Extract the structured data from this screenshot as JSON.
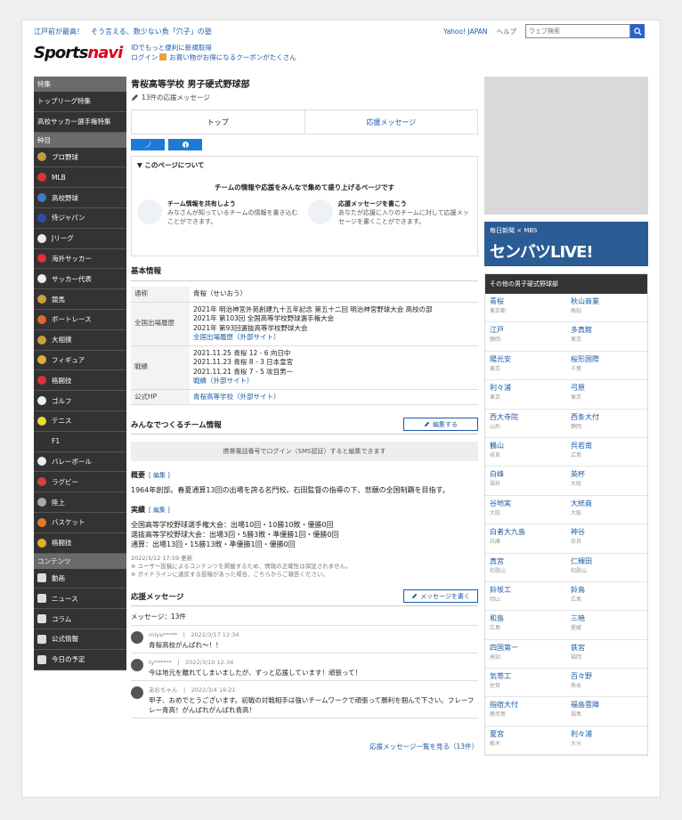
{
  "topbar": {
    "promo": "江戸前が最高！　そう言える、数少ない魚「穴子」の塾",
    "yahoo": "Yahoo! JAPAN",
    "help": "ヘルプ",
    "search_placeholder": "ウェブ検索"
  },
  "brand": {
    "logo_a": "Sports",
    "logo_b": "navi",
    "line1": "IDでもっと便利に新規取得",
    "line2a": "ログイン",
    "line2b": "お買い物がお得になるクーポンがたくさん"
  },
  "sidebar": {
    "sec1": "特集",
    "feature": [
      {
        "label": "トップリーグ特集"
      },
      {
        "label": "高校サッカー選手権特集"
      }
    ],
    "sec2": "种目",
    "sports": [
      {
        "label": "プロ野球",
        "color": "#c79a3b"
      },
      {
        "label": "MLB",
        "color": "#d33"
      },
      {
        "label": "高校野球",
        "color": "#3b7bc7"
      },
      {
        "label": "侍ジャパン",
        "color": "#2a4ea8"
      },
      {
        "label": "Jリーグ",
        "color": "#eee"
      },
      {
        "label": "海外サッカー",
        "color": "#d33"
      },
      {
        "label": "サッカー代表",
        "color": "#eee"
      },
      {
        "label": "競馬",
        "color": "#c9a13a"
      },
      {
        "label": "ボートレース",
        "color": "#e06a2a"
      },
      {
        "label": "大相撲",
        "color": "#c9a13a"
      },
      {
        "label": "フィギュア",
        "color": "#e0b030"
      },
      {
        "label": "格闘技",
        "color": "#d33"
      },
      {
        "label": "ゴルフ",
        "color": "#eee"
      },
      {
        "label": "テニス",
        "color": "#e8e02a"
      },
      {
        "label": "F1",
        "color": "#333"
      },
      {
        "label": "バレーボール",
        "color": "#eee"
      },
      {
        "label": "ラグビー",
        "color": "#c44"
      },
      {
        "label": "陸上",
        "color": "#aaa"
      },
      {
        "label": "バスケット",
        "color": "#e07a2a"
      },
      {
        "label": "格闘技",
        "color": "#e0b030"
      }
    ],
    "sec3": "コンテンツ",
    "contents": [
      {
        "label": "動画"
      },
      {
        "label": "ニュース"
      },
      {
        "label": "コラム"
      },
      {
        "label": "公式情報"
      },
      {
        "label": "今日の予定"
      }
    ]
  },
  "main": {
    "title": "青桜高等学校 男子硬式野球部",
    "sub": "13件の応援メッセージ",
    "tab_top": "トップ",
    "tab_msg": "応援メッセージ",
    "about_head": "▼ このページについて",
    "about_lead": "チームの情報や応援をみんなで集めて盛り上げるページです",
    "about_c1_t": "チーム情報を共有しよう",
    "about_c1_d": "みなさんが知っているチームの情報を書き込むことができます。",
    "about_c2_t": "応援メッセージを書こう",
    "about_c2_d": "あなたが応援に入りのチームに対して応援メッセージを書くことができます。",
    "basic_head": "基本情報",
    "r1k": "通称",
    "r1v": "青桜（せいおう）",
    "r2k": "全国出場履歴",
    "r2v": [
      "2021年 明治神宮外苑創建九十五年記念 第五十二回 明治神宮野球大会 高校の部",
      "2021年 第103回 全国高等学校野球選手権大会",
      "2021年 第93回選抜高等学校野球大会",
      "全国出場履歴（外部サイト）"
    ],
    "r3k": "戦績",
    "r3v": [
      "2021.11.25 青桜 12 - 6 向日中",
      "2021.11.23 青桜 8 - 3 日本皇宮",
      "2021.11.21 青桜 7 - 5 攻目男一",
      "戦績（外部サイト）"
    ],
    "r4k": "公式HP",
    "r4v": "青桜高等学校（外部サイト）",
    "team_head": "みんなでつくるチーム情報",
    "edit": "編集する",
    "login": "携帯電話番号でログイン（SMS認証）すると編集できます",
    "outline_l": "概要",
    "outline_e": "[ 編集 ]",
    "outline": "1964年創部。春夏通算13回の出場を誇る名門校。石田監督の指導の下、悲願の全国制覇を目指す。",
    "record_l": "実績",
    "record_e": "[ 編集 ]",
    "record": [
      "全国高等学校野球選手権大会：出場10回・10勝10敗・優勝0回",
      "選抜高等学校野球大会：出場3回・5勝3敗・準優勝1回・優勝0回",
      "通算：出場13回・15勝13敗・準優勝1回・優勝0回"
    ],
    "note": [
      "2022/3/12 17:59 更新",
      "※ ユーザー投稿によるコンテンツを掲載するため、情報の正確性は保証されません。",
      "※ ガイドラインに違反する投稿があった場合、こちらからご報告ください。"
    ],
    "msg_head": "応援メッセージ",
    "msg_btn": "メッセージを書く",
    "msg_count": "メッセージ：13件",
    "msgs": [
      {
        "meta": "miya*****　|　2022/3/17 12:34",
        "body": "青桜高校がんばれ〜！！"
      },
      {
        "meta": "ty******　|　2022/3/10 12:34",
        "body": "今は地元を離れてしまいましたが、ずっと応援しています！頑張って！"
      },
      {
        "meta": "あおちゃん　|　2022/3/4 16:21",
        "body": "甲子、おめでとうございます。初戦の対戦相手は強いチームワークで頑張って勝利を掴んで下さい。フレーフレー青高！がんばれがんばれ青高！"
      }
    ],
    "more": "応援メッセージ一覧を見る（13件）"
  },
  "right": {
    "banner_t1": "毎日新聞 × MBS",
    "banner_t2": "センバツLIVE!",
    "teams_head": "その他の男子硬式野球部",
    "teams": [
      {
        "n": "青桜",
        "p": "東京都"
      },
      {
        "n": "秋山商業",
        "p": "高知"
      },
      {
        "n": "江戸",
        "p": "静岡"
      },
      {
        "n": "多真館",
        "p": "東京"
      },
      {
        "n": "陽光安",
        "p": "東京"
      },
      {
        "n": "桜形国際",
        "p": "千葉"
      },
      {
        "n": "利々浦",
        "p": "東京"
      },
      {
        "n": "弓原",
        "p": "東京"
      },
      {
        "n": "西大寺院",
        "p": "山形"
      },
      {
        "n": "西条大付",
        "p": "静岡"
      },
      {
        "n": "鶴山",
        "p": "岐阜"
      },
      {
        "n": "呉若南",
        "p": "広島"
      },
      {
        "n": "白峰",
        "p": "福井"
      },
      {
        "n": "英杯",
        "p": "大阪"
      },
      {
        "n": "谷地実",
        "p": "大阪"
      },
      {
        "n": "大統商",
        "p": "大阪"
      },
      {
        "n": "白者大九島",
        "p": "兵庫"
      },
      {
        "n": "神谷",
        "p": "奈良"
      },
      {
        "n": "真宮",
        "p": "和歌山"
      },
      {
        "n": "仁輝田",
        "p": "和歌山"
      },
      {
        "n": "鈴坂工",
        "p": "岡山"
      },
      {
        "n": "鈴鳥",
        "p": "広島"
      },
      {
        "n": "和島",
        "p": "広島"
      },
      {
        "n": "三暁",
        "p": "愛媛"
      },
      {
        "n": "四国第一",
        "p": "高知"
      },
      {
        "n": "鉄宮",
        "p": "福岡"
      },
      {
        "n": "気帯工",
        "p": "佐賀"
      },
      {
        "n": "百々野",
        "p": "熊本"
      },
      {
        "n": "指宿大付",
        "p": "鹿児島"
      },
      {
        "n": "福島雲陣",
        "p": "福島"
      },
      {
        "n": "夏宮",
        "p": "栃木"
      },
      {
        "n": "利々浦",
        "p": "大分"
      }
    ]
  }
}
